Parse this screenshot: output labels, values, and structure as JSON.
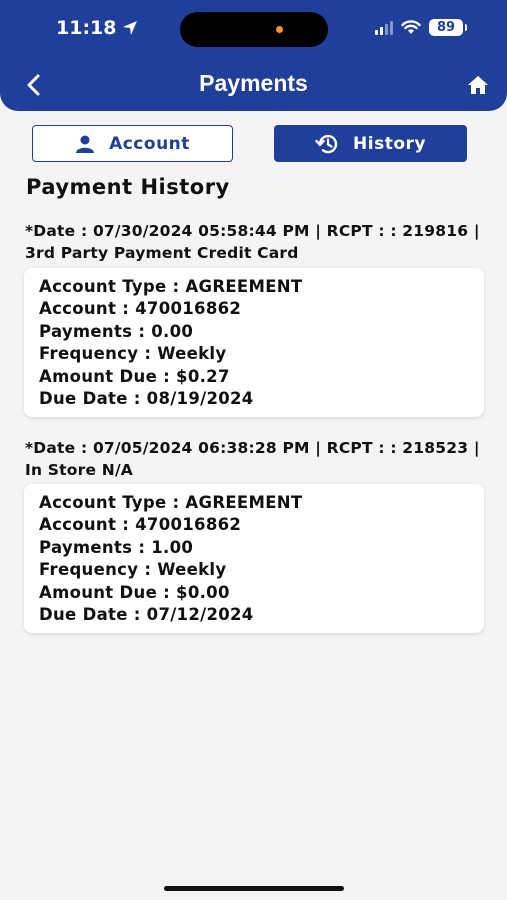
{
  "status_bar": {
    "time": "11:18",
    "battery": "89"
  },
  "header": {
    "title": "Payments"
  },
  "tabs": {
    "account": "Account",
    "history": "History"
  },
  "section_title": "Payment History",
  "colors": {
    "primary": "#1f3f9a",
    "background": "#f4f4f6"
  },
  "entries": [
    {
      "header": "*Date : 07/30/2024 05:58:44 PM | RCPT : : 219816 | 3rd Party Payment Credit Card",
      "lines": [
        "Account Type : AGREEMENT",
        "Account : 470016862",
        "Payments : 0.00",
        "Frequency : Weekly",
        "Amount Due : $0.27",
        "Due Date : 08/19/2024"
      ]
    },
    {
      "header": "*Date : 07/05/2024 06:38:28 PM | RCPT : : 218523 | In Store N/A",
      "lines": [
        "Account Type : AGREEMENT",
        "Account : 470016862",
        "Payments : 1.00",
        "Frequency : Weekly",
        "Amount Due : $0.00",
        "Due Date : 07/12/2024"
      ]
    }
  ]
}
